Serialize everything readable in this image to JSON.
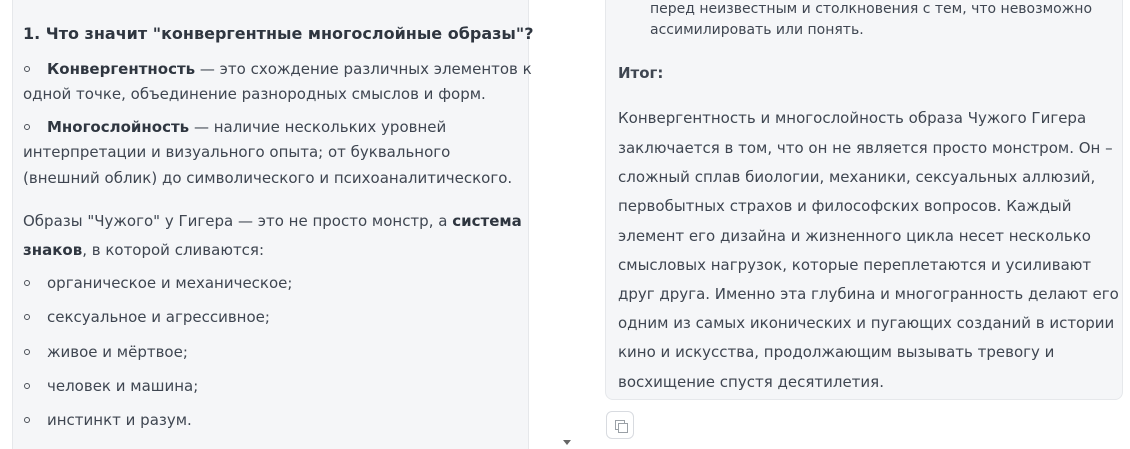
{
  "left": {
    "heading": "1. Что значит \"конвергентные многослойные образы\"?",
    "item1": {
      "term": "Конвергентность",
      "line1_rest": " — это схождение различных элементов к",
      "line2": "одной точке, объединение разнородных смыслов и форм."
    },
    "item2": {
      "term": "Многослойность",
      "line1_rest": " — наличие нескольких уровней",
      "line2": "интерпретации и визуального опыта; от буквального",
      "line3": "(внешний облик) до символического и психоаналитического."
    },
    "paragraph": {
      "line1_prefix": "Образы \"Чужого\" у Гигера — это не просто монстр, а ",
      "line1_bold": "система",
      "line2_bold": "знаков",
      "line2_rest": ", в которой сливаются:"
    },
    "list": [
      "органическое и механическое;",
      "сексуальное и агрессивное;",
      "живое и мёртвое;",
      "человек и машина;",
      "инстинкт и разум."
    ]
  },
  "right": {
    "top_lines": [
      "перед неизвестным и столкновения с тем, что невозможно",
      "ассимилировать или понять."
    ],
    "summary_heading": "Итог:",
    "summary_lines": [
      "Конвергентность и многослойность образа Чужого Гигера",
      "заключается в том, что он не является просто монстром. Он –",
      "сложный сплав биологии, механики, сексуальных аллюзий,",
      "первобытных страхов и философских вопросов. Каждый",
      "элемент его дизайна и жизненного цикла несет несколько",
      "смысловых нагрузок, которые переплетаются и усиливают",
      "друг друга. Именно эта глубина и многогранность делают его",
      "одним из самых иконических и пугающих созданий в истории",
      "кино и искусства, продолжающим вызывать тревогу и",
      "восхищение спустя десятилетия."
    ]
  }
}
